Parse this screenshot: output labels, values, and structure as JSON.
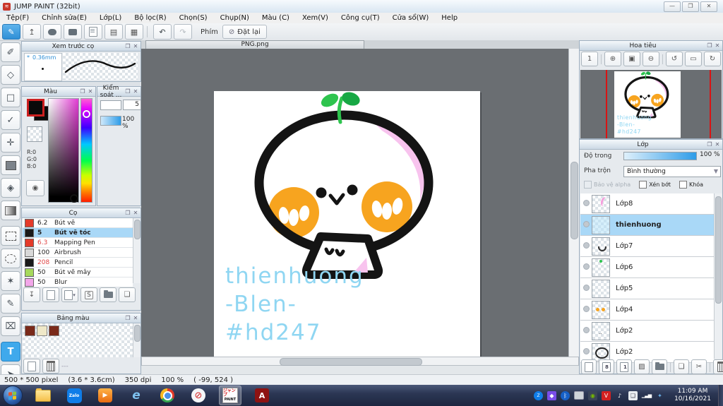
{
  "window": {
    "title": "JUMP PAINT (32bit)",
    "minimize": "—",
    "restore": "❐",
    "close": "✕"
  },
  "menu": {
    "items": [
      "Tệp(F)",
      "Chỉnh sửa(E)",
      "Lớp(L)",
      "Bộ lọc(R)",
      "Chọn(S)",
      "Chụp(N)",
      "Màu (C)",
      "Xem(V)",
      "Công cụ(T)",
      "Cửa sổ(W)",
      "Help"
    ]
  },
  "toolbar": {
    "key_label": "Phím",
    "reset_label": "Đặt lại"
  },
  "brush_preview": {
    "title": "Xem trước cọ",
    "size_label": "0.36mm"
  },
  "color_panel": {
    "title": "Màu",
    "r": "R:0",
    "g": "G:0",
    "b": "B:0"
  },
  "control_panel": {
    "title": "Kiểm soát ...",
    "size_value": "5",
    "opacity_value": "100 %"
  },
  "brushes": {
    "title": "Cọ",
    "items": [
      {
        "size": "6.2",
        "name": "Bút vẽ",
        "color": "#e43b2a",
        "size_color": "#1a1a1a"
      },
      {
        "size": "5",
        "name": "Bút vẽ tóc",
        "color": "#1a1a1a",
        "size_color": "#1a1a1a"
      },
      {
        "size": "6.3",
        "name": "Mapping Pen",
        "color": "#e43b2a",
        "size_color": "#e04545"
      },
      {
        "size": "100",
        "name": "Airbrush",
        "color": "#d8d8d8",
        "size_color": "#1a1a1a"
      },
      {
        "size": "208",
        "name": "Pencil",
        "color": "#1a1a1a",
        "size_color": "#e04545"
      },
      {
        "size": "50",
        "name": "Bút vẽ mây",
        "color": "#a6d95c",
        "size_color": "#1a1a1a"
      },
      {
        "size": "50",
        "name": "Blur",
        "color": "#f2a6e9",
        "size_color": "#1a1a1a"
      }
    ]
  },
  "palette_panel": {
    "title": "Bảng màu",
    "swatches": [
      "#7a2a1a",
      "#efe8c8",
      "#7a2a1a"
    ],
    "footer_text": "---"
  },
  "canvas": {
    "tab": "PNG.png",
    "watermark": [
      "thienhuong",
      "-Blen-",
      "#hd247"
    ]
  },
  "artwork": {
    "outline": "#141414",
    "cheek": "#f7a41f",
    "blush_pink": "#f8c3ee",
    "sprout_light": "#2ec44e",
    "sprout_dark": "#17a844",
    "watermark_color": "#8fd6f2"
  },
  "navigator": {
    "title": "Hoa tiêu"
  },
  "layers": {
    "title": "Lớp",
    "opacity_label": "Độ trong",
    "opacity_value": "100 %",
    "blend_label": "Pha trộn",
    "blend_value": "Bình thường",
    "cb_alpha": "Bảo vệ alpha",
    "cb_clip": "Xén bớt",
    "cb_lock": "Khóa",
    "items": [
      {
        "name": "Lớp8"
      },
      {
        "name": "thienhuong"
      },
      {
        "name": "Lớp7"
      },
      {
        "name": "Lớp6"
      },
      {
        "name": "Lớp5"
      },
      {
        "name": "Lớp4"
      },
      {
        "name": "Lớp2"
      },
      {
        "name": "Lớp2"
      }
    ]
  },
  "statusbar": {
    "parts": [
      "500 * 500 pixel",
      "(3.6 * 3.6cm)",
      "350 dpi",
      "100 %",
      "( -99, 524 )"
    ]
  },
  "taskbar": {
    "zalo_label": "Zalo",
    "ie_label": "e",
    "jump_label_top": "ジャンプ",
    "jump_label_bottom": "PAINT",
    "adobe_label": "A",
    "clock_time": "11:09 AM",
    "clock_date": "10/16/2021"
  }
}
